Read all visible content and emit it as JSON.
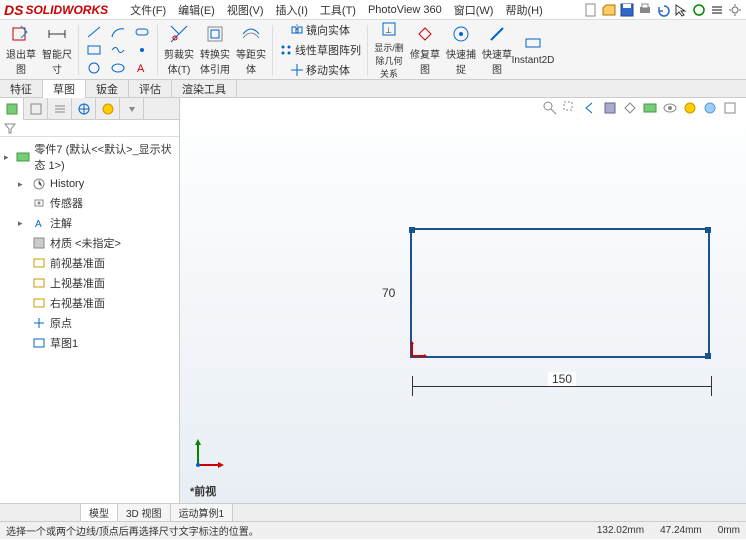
{
  "app": {
    "brand": "SOLIDWORKS"
  },
  "menu": {
    "file": "文件(F)",
    "edit": "编辑(E)",
    "view": "视图(V)",
    "insert": "插入(I)",
    "tools": "工具(T)",
    "pv360": "PhotoView 360",
    "window": "窗口(W)",
    "help": "帮助(H)"
  },
  "ribbon": {
    "exit_sketch": "退出草图",
    "smart_dim": "智能尺寸",
    "trim": "剪裁实体(T)",
    "convert": "转换实体引用",
    "offset": "等距实体",
    "mirror": "镜向实体",
    "linear_pattern": "线性草图阵列",
    "move": "移动实体",
    "display_delete": "显示/删除几何关系",
    "repair": "修复草图",
    "quick_snap": "快速捕捉",
    "quick_sketch": "快速草图",
    "instant2d": "Instant2D"
  },
  "tabs": {
    "feature": "特征",
    "sketch": "草图",
    "sheetmetal": "钣金",
    "evaluate": "评估",
    "render": "渲染工具"
  },
  "tree": {
    "root": "零件7 (默认<<默认>_显示状态 1>)",
    "history": "History",
    "sensors": "传感器",
    "annotations": "注解",
    "material": "材质 <未指定>",
    "front": "前视基准面",
    "top": "上视基准面",
    "right": "右视基准面",
    "origin": "原点",
    "sketch1": "草图1"
  },
  "sketch_dims": {
    "width": "150",
    "height": "70"
  },
  "view_name": "*前视",
  "bottom_tabs": {
    "model": "模型",
    "view3d": "3D 视图",
    "motion": "运动算例1"
  },
  "status": {
    "msg": "选择一个或两个边线/顶点后再选择尺寸文字标注的位置。",
    "x": "132.02mm",
    "y": "47.24mm",
    "z": "0mm"
  }
}
